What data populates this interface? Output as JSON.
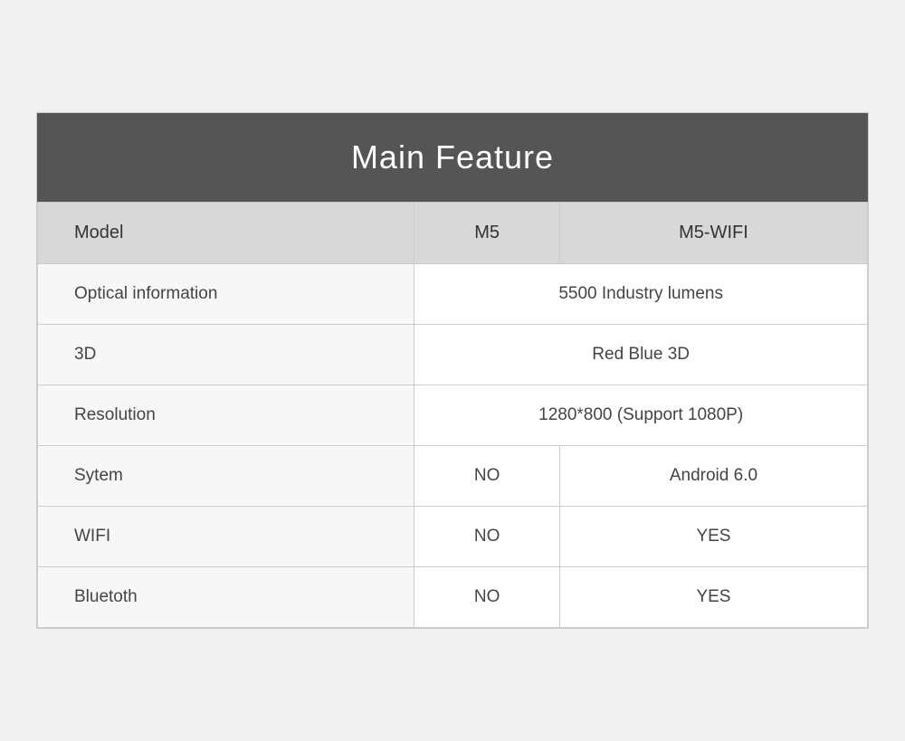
{
  "header": {
    "title": "Main Feature"
  },
  "columns": {
    "col1": "Model",
    "col2": "M5",
    "col3": "M5-WIFI"
  },
  "rows": [
    {
      "feature": "Optical information",
      "colspan": true,
      "value": "5500 Industry lumens",
      "m5": null,
      "m5wifi": null
    },
    {
      "feature": "3D",
      "colspan": true,
      "value": "Red Blue 3D",
      "m5": null,
      "m5wifi": null
    },
    {
      "feature": "Resolution",
      "colspan": true,
      "value": "1280*800 (Support 1080P)",
      "m5": null,
      "m5wifi": null
    },
    {
      "feature": "Sytem",
      "colspan": false,
      "value": null,
      "m5": "NO",
      "m5wifi": "Android 6.0"
    },
    {
      "feature": "WIFI",
      "colspan": false,
      "value": null,
      "m5": "NO",
      "m5wifi": "YES"
    },
    {
      "feature": "Bluetoth",
      "colspan": false,
      "value": null,
      "m5": "NO",
      "m5wifi": "YES"
    }
  ]
}
